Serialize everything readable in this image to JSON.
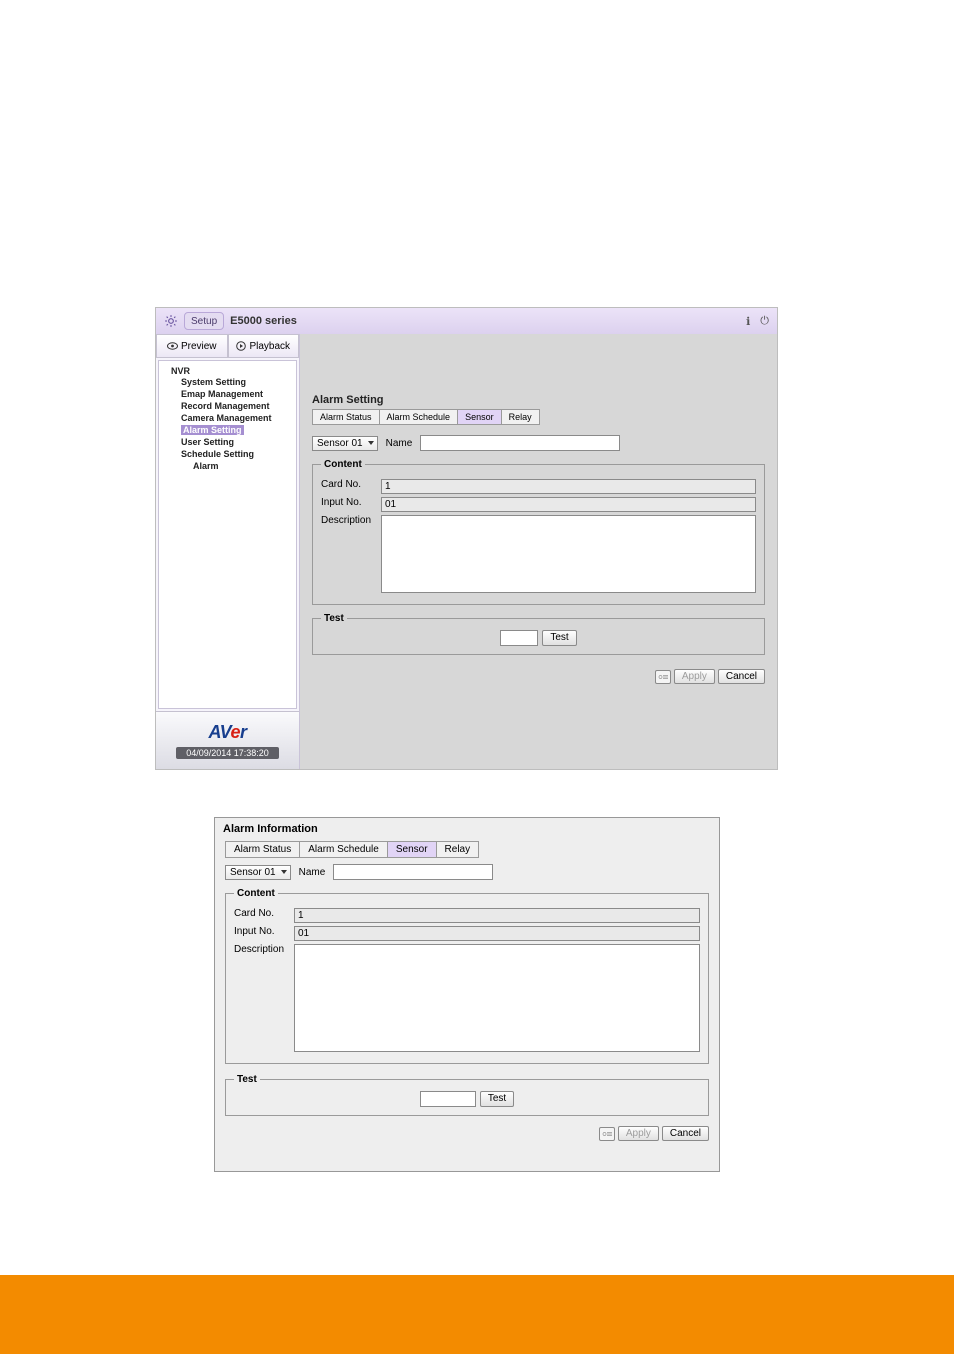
{
  "shot1": {
    "titlebar": {
      "setup": "Setup",
      "series": "E5000 series"
    },
    "left_tabs": {
      "preview": "Preview",
      "playback": "Playback"
    },
    "tree": {
      "root": "NVR",
      "items": [
        "System Setting",
        "Emap Management",
        "Record Management",
        "Camera Management",
        "Alarm Setting",
        "User Setting",
        "Schedule Setting",
        "Alarm"
      ],
      "selected_index": 4
    },
    "timestamp": "04/09/2014 17:38:20",
    "panel_title": "Alarm Setting",
    "tabs": [
      "Alarm Status",
      "Alarm Schedule",
      "Sensor",
      "Relay"
    ],
    "active_tab": 2,
    "sensor_select": "Sensor 01",
    "name_label": "Name",
    "content": {
      "legend": "Content",
      "card_label": "Card No.",
      "card_value": "1",
      "input_label": "Input No.",
      "input_value": "01",
      "desc_label": "Description"
    },
    "test": {
      "legend": "Test",
      "button": "Test"
    },
    "buttons": {
      "apply": "Apply",
      "cancel": "Cancel"
    }
  },
  "shot2": {
    "title": "Alarm Information",
    "tabs": [
      "Alarm Status",
      "Alarm Schedule",
      "Sensor",
      "Relay"
    ],
    "active_tab": 2,
    "sensor_select": "Sensor 01",
    "name_label": "Name",
    "content": {
      "legend": "Content",
      "card_label": "Card No.",
      "card_value": "1",
      "input_label": "Input No.",
      "input_value": "01",
      "desc_label": "Description"
    },
    "test": {
      "legend": "Test",
      "button": "Test"
    },
    "buttons": {
      "apply": "Apply",
      "cancel": "Cancel"
    }
  }
}
